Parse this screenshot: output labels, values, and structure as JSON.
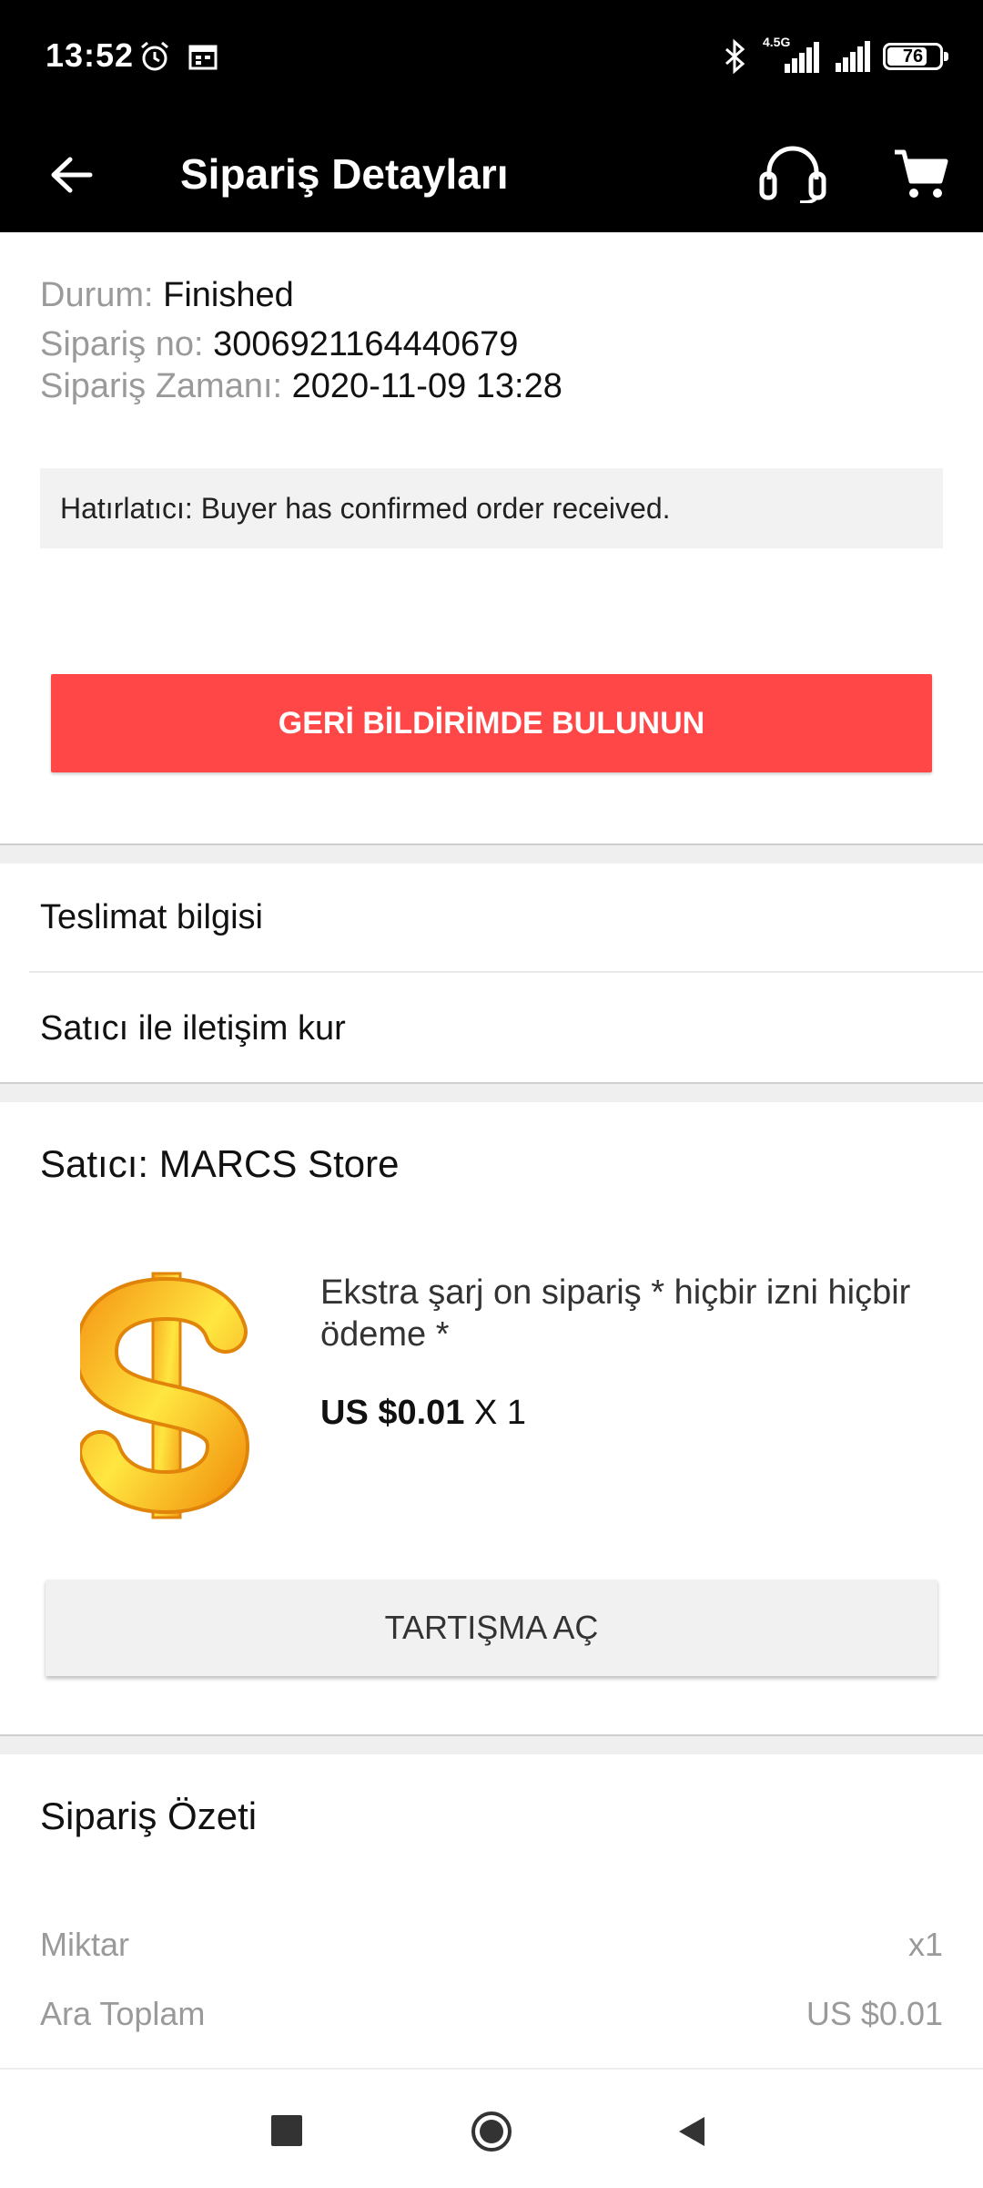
{
  "status_bar": {
    "time": "13:52",
    "network_label": "4.5G",
    "battery_level": "76",
    "battery_fraction": 0.76
  },
  "app_bar": {
    "title": "Sipariş Detayları",
    "icons": [
      "back-arrow-icon",
      "headset-icon",
      "cart-icon"
    ]
  },
  "order": {
    "status_label": "Durum:",
    "status_value": "Finished",
    "number_label": "Sipariş no:",
    "number_value": "3006921164440679",
    "time_label": "Sipariş Zamanı:",
    "time_value": "2020-11-09 13:28",
    "reminder": "Hatırlatıcı: Buyer has confirmed order received.",
    "feedback_button": "GERİ BİLDİRİMDE BULUNUN"
  },
  "links": {
    "delivery_info": "Teslimat bilgisi",
    "contact_seller": "Satıcı ile iletişim kur"
  },
  "seller": {
    "label": "Satıcı: MARCS Store"
  },
  "product": {
    "title": "Ekstra şarj on sipariş * hiçbir izni hiçbir ödeme *",
    "price": "US $0.01",
    "quantity": "X 1",
    "image": "gold-dollar-sign"
  },
  "dispute_button": "TARTIŞMA AÇ",
  "summary": {
    "title": "Sipariş Özeti",
    "rows": [
      {
        "label": "Miktar",
        "value": "x1"
      },
      {
        "label": "Ara Toplam",
        "value": "US $0.01"
      }
    ]
  },
  "colors": {
    "accent": "#ff4747",
    "bar_bg": "#000000",
    "muted_text": "#9a9a9a"
  }
}
